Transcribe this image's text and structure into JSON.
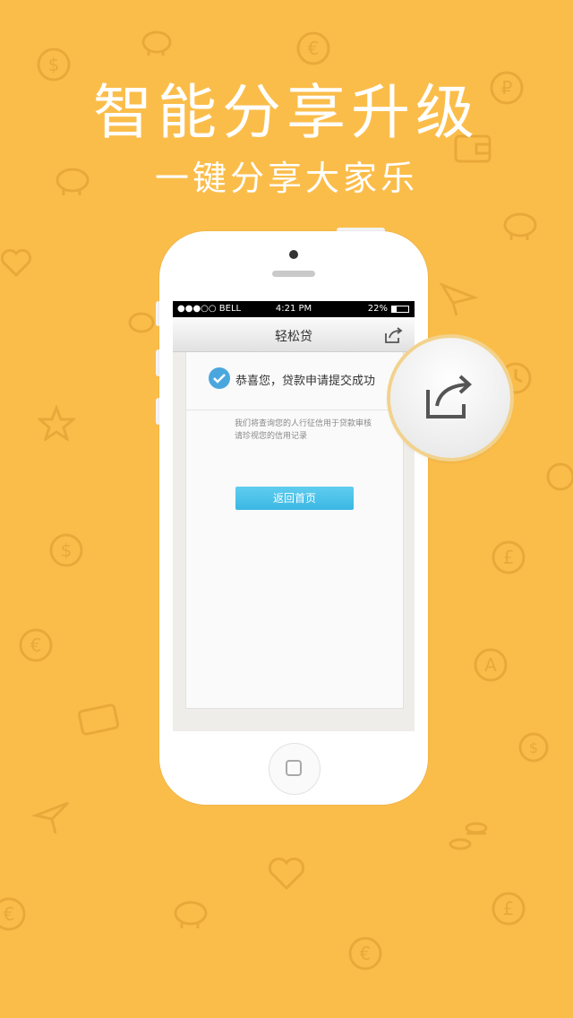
{
  "headline": "智能分享升级",
  "subheadline": "一键分享大家乐",
  "status_bar": {
    "carrier": "●●●○○ BELL",
    "time": "4:21 PM",
    "battery": "22%"
  },
  "app": {
    "title": "轻松贷",
    "success_message": "恭喜您，贷款申请提交成功",
    "note_line1": "我们将查询您的人行征信用于贷款审核",
    "note_line2": "请珍视您的信用记录",
    "return_button": "返回首页"
  },
  "colors": {
    "background": "#fbbd4a",
    "accent": "#4aa7de",
    "button": "#3bb7e4"
  },
  "icons": [
    "share-icon",
    "check-icon",
    "home-button-icon",
    "piggy-bank-icon",
    "dollar-icon",
    "euro-icon",
    "ruble-icon",
    "pound-icon",
    "wallet-icon",
    "heart-icon",
    "paper-plane-icon",
    "star-icon",
    "credit-card-icon",
    "money-bag-icon",
    "coins-icon",
    "clock-icon",
    "a-icon"
  ]
}
